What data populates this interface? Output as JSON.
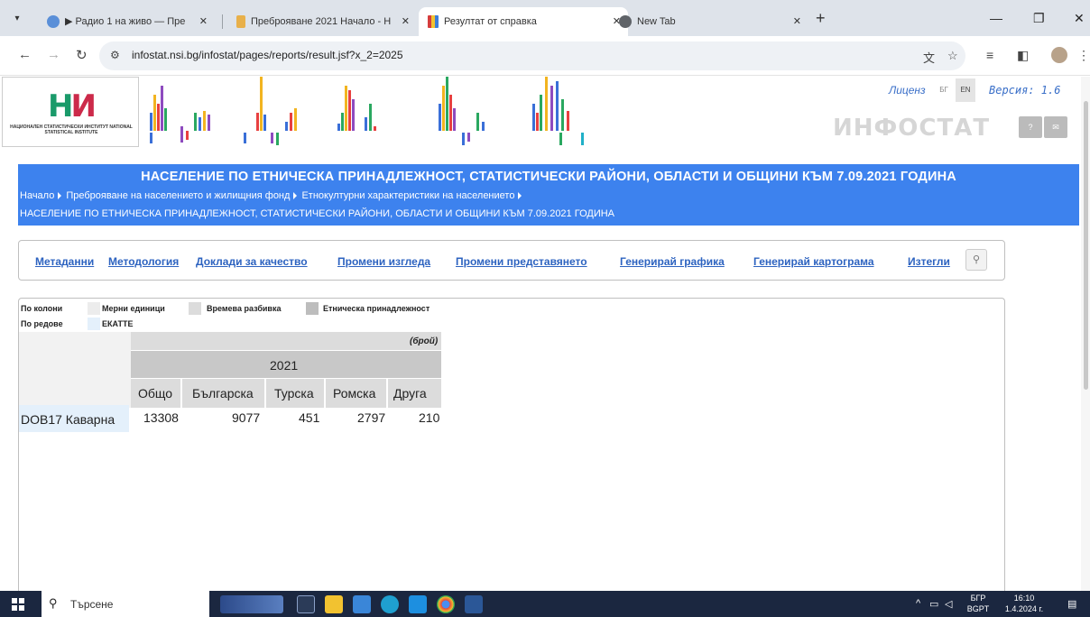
{
  "browser": {
    "tabs": [
      {
        "title": "▶ Радио 1 на живо — Пре",
        "active": false
      },
      {
        "title": "Преброяване 2021 Начало - Н",
        "active": false
      },
      {
        "title": "Резултат от справка",
        "active": true
      },
      {
        "title": "New Tab",
        "active": false
      }
    ],
    "tab_close": "✕",
    "new_tab": "+",
    "url": "infostat.nsi.bg/infostat/pages/reports/result.jsf?x_2=2025"
  },
  "header": {
    "logo_text": "НАЦИОНАЛЕН СТАТИСТИЧЕСКИ ИНСТИТУТ NATIONAL STATISTICAL INSTITUTE",
    "license": "Лиценз",
    "lang_bg": "БГ",
    "lang_en": "EN",
    "version": "Версия: 1.6",
    "brand": "ИНФОСТАТ",
    "help_btn": "?",
    "mail_btn": "✉"
  },
  "banner": {
    "title": "НАСЕЛЕНИЕ ПО ЕТНИЧЕСКА ПРИНАДЛЕЖНОСТ, СТАТИСТИЧЕСКИ РАЙОНИ, ОБЛАСТИ И ОБЩИНИ КЪМ 7.09.2021 ГОДИНА",
    "crumbs": [
      "Начало",
      "Преброяване на населението и жилищния фонд",
      "Етнокултурни характеристики на населението"
    ],
    "crumb_last": "НАСЕЛЕНИЕ ПО ЕТНИЧЕСКА ПРИНАДЛЕЖНОСТ, СТАТИСТИЧЕСКИ РАЙОНИ, ОБЛАСТИ И ОБЩИНИ КЪМ 7.09.2021 ГОДИНА"
  },
  "menu": {
    "metadata": "Метаданни",
    "methodology": "Методология",
    "quality": "Доклади за качество",
    "change_view": "Промени изгледа",
    "change_repr": "Промени представянето",
    "gen_chart": "Генерирай графика",
    "gen_map": "Генерирай картограма",
    "download": "Изтегли"
  },
  "layout_dims": {
    "by_columns": "По колони",
    "by_rows": "По редове",
    "units": "Мерни единици",
    "time": "Времева разбивка",
    "ethnic": "Етническа принадлежност",
    "ekatte": "ЕКАТТЕ"
  },
  "table": {
    "unit": "(брой)",
    "year": "2021",
    "columns": [
      "Общо",
      "Българска",
      "Турска",
      "Ромска",
      "Друга"
    ],
    "row_label": "DOB17 Каварна",
    "values": [
      "13308",
      "9077",
      "451",
      "2797",
      "210"
    ]
  },
  "taskbar": {
    "search": "Търсене",
    "lang": "БГР",
    "layout": "BGPT",
    "time": "16:10",
    "date": "1.4.2024 г."
  }
}
